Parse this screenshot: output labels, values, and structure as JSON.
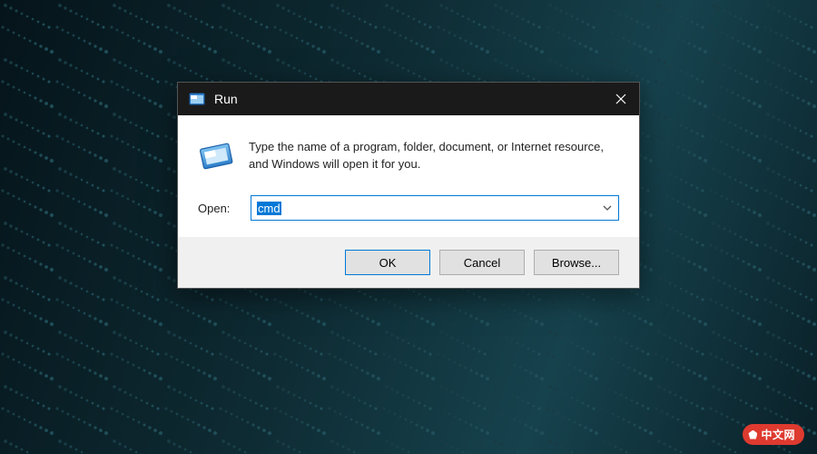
{
  "dialog": {
    "title": "Run",
    "description": "Type the name of a program, folder, document, or Internet resource, and Windows will open it for you.",
    "open_label": "Open:",
    "input_value": "cmd",
    "buttons": {
      "ok": "OK",
      "cancel": "Cancel",
      "browse": "Browse..."
    }
  },
  "watermark": "中文网"
}
